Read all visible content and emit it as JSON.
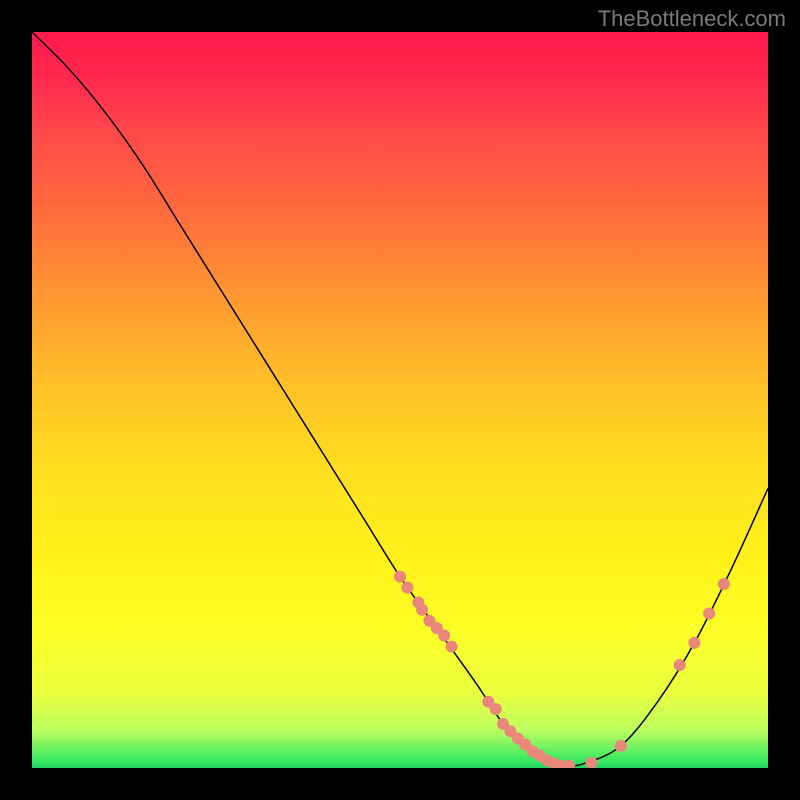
{
  "watermark": "TheBottleneck.com",
  "chart_data": {
    "type": "line",
    "title": "",
    "xlabel": "",
    "ylabel": "",
    "xlim": [
      0,
      100
    ],
    "ylim": [
      0,
      100
    ],
    "series": [
      {
        "name": "bottleneck-curve",
        "x": [
          0,
          5,
          10,
          15,
          20,
          25,
          30,
          35,
          40,
          45,
          50,
          55,
          60,
          62,
          64,
          66,
          68,
          70,
          72,
          75,
          80,
          85,
          90,
          95,
          100
        ],
        "y": [
          100,
          95,
          89,
          82,
          74,
          66,
          58,
          50,
          42,
          34,
          26,
          19,
          12,
          9,
          6,
          4,
          2.2,
          1,
          0.3,
          0.6,
          3,
          9,
          17,
          27,
          38
        ]
      }
    ],
    "scatter_points": {
      "name": "markers",
      "x": [
        50,
        51,
        52.5,
        53,
        54,
        55,
        56,
        57,
        62,
        63,
        64,
        65,
        66,
        67,
        68,
        69,
        70,
        71,
        72,
        73,
        76,
        80,
        88,
        90,
        92,
        94
      ],
      "y": [
        26,
        24.5,
        22.5,
        21.5,
        20,
        19,
        18,
        16.5,
        9,
        8,
        6,
        5,
        4,
        3.2,
        2.3,
        1.7,
        1,
        0.6,
        0.3,
        0.3,
        0.7,
        3,
        14,
        17,
        21,
        25
      ]
    },
    "scatter_radius": 6
  }
}
